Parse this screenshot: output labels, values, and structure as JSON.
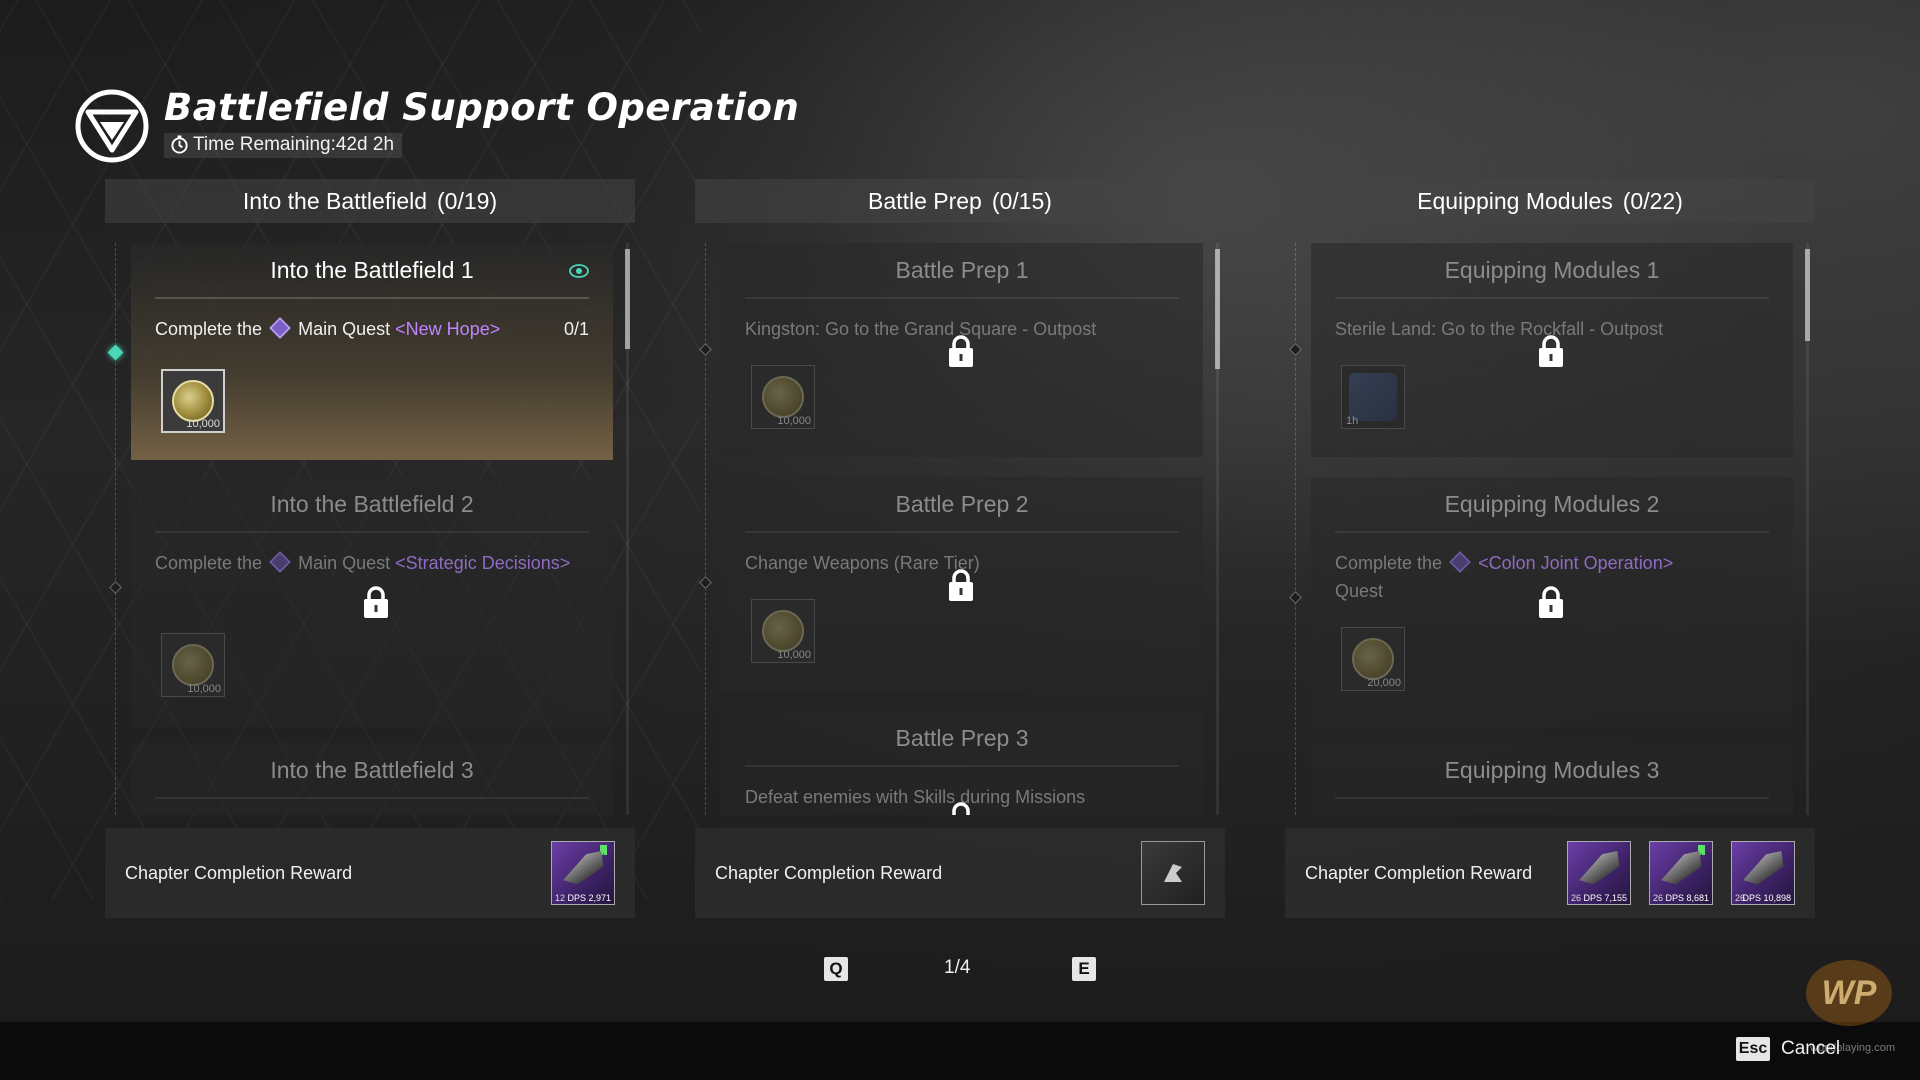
{
  "header": {
    "title": "Battlefield Support Operation",
    "time_remaining": "Time Remaining:42d 2h"
  },
  "columns": [
    {
      "name": "Into the Battlefield",
      "count": "(0/19)",
      "quests": [
        {
          "title": "Into the Battlefield 1",
          "desc_prefix": "Complete the",
          "desc_mid": "Main Quest",
          "desc_highlight": "<New Hope>",
          "progress": "0/1",
          "reward_amount": "10,000",
          "locked": false,
          "active": true
        },
        {
          "title": "Into the Battlefield 2",
          "desc_prefix": "Complete the",
          "desc_mid": "Main Quest",
          "desc_highlight": "<Strategic Decisions>",
          "reward_amount": "10,000",
          "locked": true
        },
        {
          "title": "Into the Battlefield 3"
        }
      ],
      "completion": {
        "label": "Chapter Completion Reward",
        "items": [
          {
            "level": "12",
            "dps": "DPS 2,971"
          }
        ]
      }
    },
    {
      "name": "Battle Prep",
      "count": "(0/15)",
      "quests": [
        {
          "title": "Battle Prep 1",
          "desc": "Kingston: Go to the Grand Square - Outpost",
          "reward_amount": "10,000",
          "locked": true
        },
        {
          "title": "Battle Prep 2",
          "desc": "Change Weapons (Rare Tier)",
          "reward_amount": "10,000",
          "locked": true
        },
        {
          "title": "Battle Prep 3",
          "desc": "Defeat enemies with Skills during Missions",
          "locked": true
        }
      ],
      "completion": {
        "label": "Chapter Completion Reward"
      }
    },
    {
      "name": "Equipping Modules",
      "count": "(0/22)",
      "quests": [
        {
          "title": "Equipping Modules 1",
          "desc": "Sterile Land: Go to the Rockfall - Outpost",
          "reward_amount": "1h",
          "locked": true
        },
        {
          "title": "Equipping Modules 2",
          "desc_prefix": "Complete the",
          "desc_highlight": "<Colon Joint Operation>",
          "desc_suffix": "Quest",
          "reward_amount": "20,000",
          "locked": true
        },
        {
          "title": "Equipping Modules 3"
        }
      ],
      "completion": {
        "label": "Chapter Completion Reward",
        "items": [
          {
            "level": "26",
            "dps": "DPS 7,155"
          },
          {
            "level": "26",
            "dps": "DPS 8,681"
          },
          {
            "level": "26",
            "dps": "DPS 10,898"
          }
        ]
      }
    }
  ],
  "pager": {
    "prev_key": "Q",
    "next_key": "E",
    "page": "1/4"
  },
  "footer": {
    "esc_key": "Esc",
    "cancel": "Cancel"
  },
  "watermark": {
    "logo": "WP",
    "text": "worldplaying.com"
  },
  "colors": {
    "accent": "#4ad7b8",
    "quest_highlight": "#c283ff",
    "epic": "#6b3fa8"
  }
}
